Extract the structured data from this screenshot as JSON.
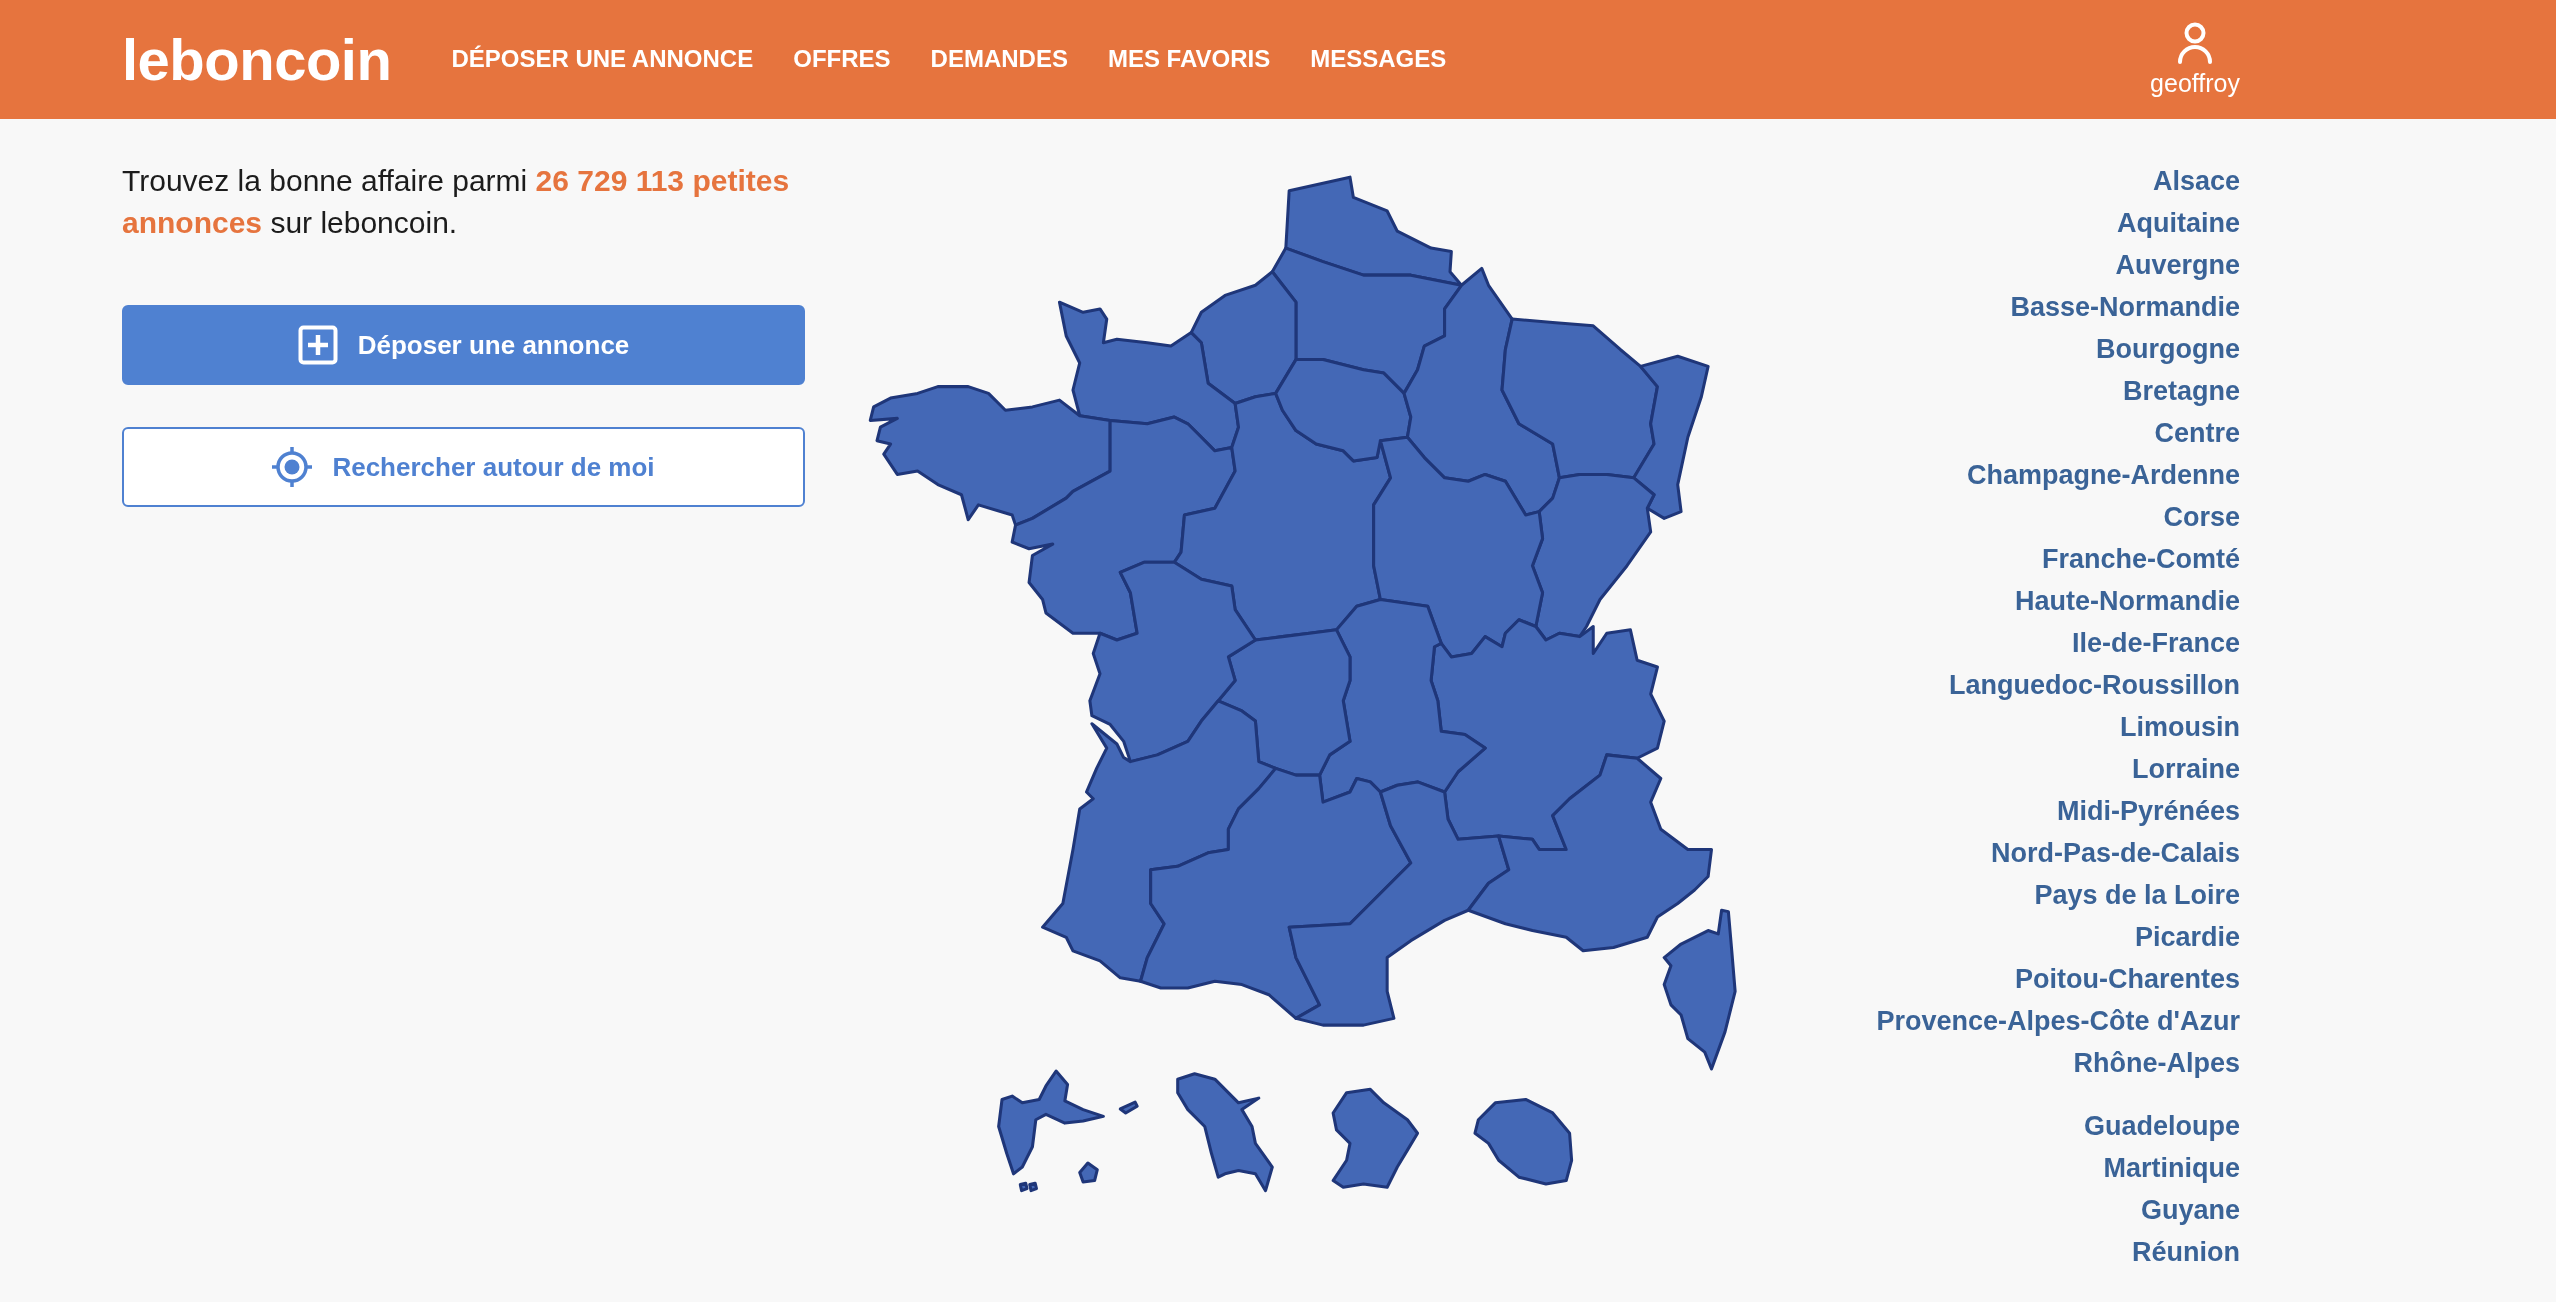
{
  "header": {
    "logo": "leboncoin",
    "nav": [
      "DÉPOSER UNE ANNONCE",
      "OFFRES",
      "DEMANDES",
      "MES FAVORIS",
      "MESSAGES"
    ],
    "user": {
      "name": "geoffroy"
    }
  },
  "intro": {
    "text": "Trouvez la bonne affaire parmi **26 729 113 petites annonces** sur leboncoin."
  },
  "buttons": [
    {
      "kind": "post",
      "label": "Déposer une annonce"
    },
    {
      "kind": "locate",
      "label": "Rechercher autour de moi"
    }
  ],
  "regions": [
    "Alsace",
    "Aquitaine",
    "Auvergne",
    "Basse-Normandie",
    "Bourgogne",
    "Bretagne",
    "Centre",
    "Champagne-Ardenne",
    "Corse",
    "Franche-Comté",
    "Haute-Normandie",
    "Ile-de-France",
    "Languedoc-Roussillon",
    "Limousin",
    "Lorraine",
    "Midi-Pyrénées",
    "Nord-Pas-de-Calais",
    "Pays de la Loire",
    "Picardie",
    "Poitou-Charentes",
    "Provence-Alpes-Côte d'Azur",
    "Rhône-Alpes"
  ],
  "overseas": [
    "Guadeloupe",
    "Martinique",
    "Guyane",
    "Réunion"
  ]
}
